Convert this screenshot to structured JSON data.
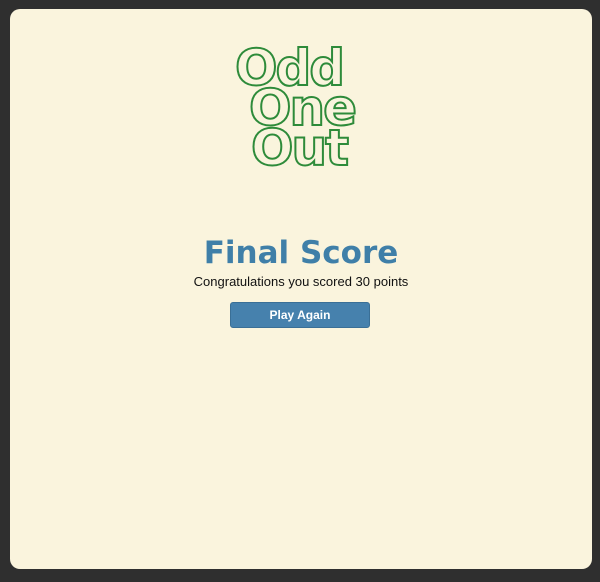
{
  "logo": {
    "line1": "Odd",
    "line2": "One",
    "line3": "Out"
  },
  "result": {
    "title": "Final Score",
    "message": "Congratulations you scored 30 points",
    "score": 30
  },
  "actions": {
    "play_again_label": "Play Again"
  },
  "colors": {
    "background": "#faf4dd",
    "frame": "#2f2f2f",
    "logo_stroke": "#2e8b3a",
    "title": "#3f7fa8",
    "button": "#4681ad"
  }
}
